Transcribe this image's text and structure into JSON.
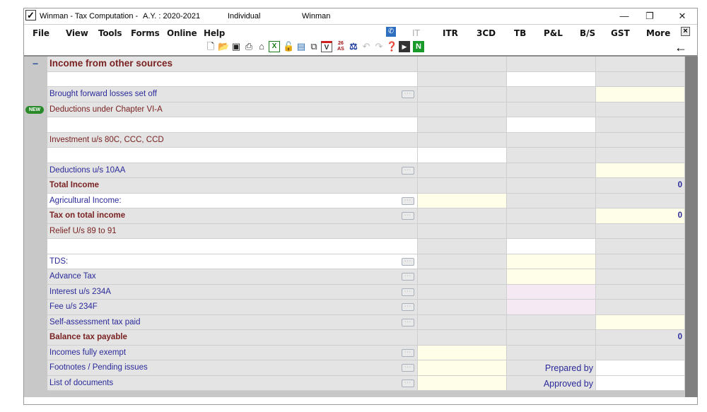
{
  "titlebar": {
    "app": "Winman - Tax Computation -",
    "assessment_year": "A.Y. : 2020-2021",
    "status": "Individual",
    "user": "Winman",
    "minimize": "—",
    "restore": "❐",
    "close": "✕"
  },
  "menubar": {
    "items": [
      "File",
      "View",
      "Tools",
      "Forms",
      "Online",
      "Help"
    ],
    "right_items": [
      "IT",
      "ITR",
      "3CD",
      "TB",
      "P&L",
      "B/S",
      "GST",
      "More"
    ],
    "close_doc": "×",
    "back_arrow": "←"
  },
  "toolbar": {
    "icons": [
      "new-file-icon",
      "open-folder-icon",
      "save-icon",
      "print-icon",
      "home-icon",
      "excel-icon",
      "lock-icon",
      "import-icon",
      "copy-icon",
      "form-v-icon",
      "26as-icon",
      "scale-icon",
      "undo-icon",
      "redo-icon",
      "help-support-icon",
      "video-icon",
      "n-icon"
    ],
    "badge_26as": "26 AS",
    "badge_n": "N"
  },
  "grid": {
    "section_toggle": "−",
    "new_badge": "NEW",
    "rows": [
      {
        "label": "Income from other sources",
        "style": "header",
        "c1": "",
        "c2": "",
        "c3": ""
      },
      {
        "label": "",
        "style": "blank"
      },
      {
        "label": "Brought forward losses set off",
        "style": "blue"
      },
      {
        "label": "Deductions under Chapter VI-A",
        "style": "maroon"
      },
      {
        "label": "",
        "style": "blank"
      },
      {
        "label": "Investment u/s 80C, CCC, CCD",
        "style": "maroon"
      },
      {
        "label": "",
        "style": "blank"
      },
      {
        "label": "Deductions u/s 10AA",
        "style": "blue"
      },
      {
        "label": "Total Income",
        "style": "maroon-bold",
        "c3": "0"
      },
      {
        "label": "Agricultural Income:",
        "style": "blue"
      },
      {
        "label": "Tax on total income",
        "style": "maroon-bold",
        "c3": "0"
      },
      {
        "label": "Relief U/s 89 to 91",
        "style": "maroon"
      },
      {
        "label": "",
        "style": "blank"
      },
      {
        "label": "TDS:",
        "style": "blue"
      },
      {
        "label": "Advance Tax",
        "style": "blue"
      },
      {
        "label": "Interest u/s 234A",
        "style": "blue"
      },
      {
        "label": "Fee u/s 234F",
        "style": "blue"
      },
      {
        "label": "Self-assessment tax paid",
        "style": "blue"
      },
      {
        "label": "Balance tax payable",
        "style": "maroon-bold",
        "c3": "0"
      },
      {
        "label": "Incomes fully exempt",
        "style": "blue"
      },
      {
        "label": "Footnotes / Pending issues",
        "style": "blue",
        "c2": "Prepared by"
      },
      {
        "label": "List of documents",
        "style": "blue",
        "c2": "Approved by"
      }
    ],
    "ellipsis": "···"
  },
  "colors": {
    "label_blue": "#2a2a9a",
    "label_maroon": "#7a2222",
    "input_yellow": "#fffee8",
    "input_pink": "#f5e9f4",
    "cell_gray": "#e4e4e4"
  }
}
